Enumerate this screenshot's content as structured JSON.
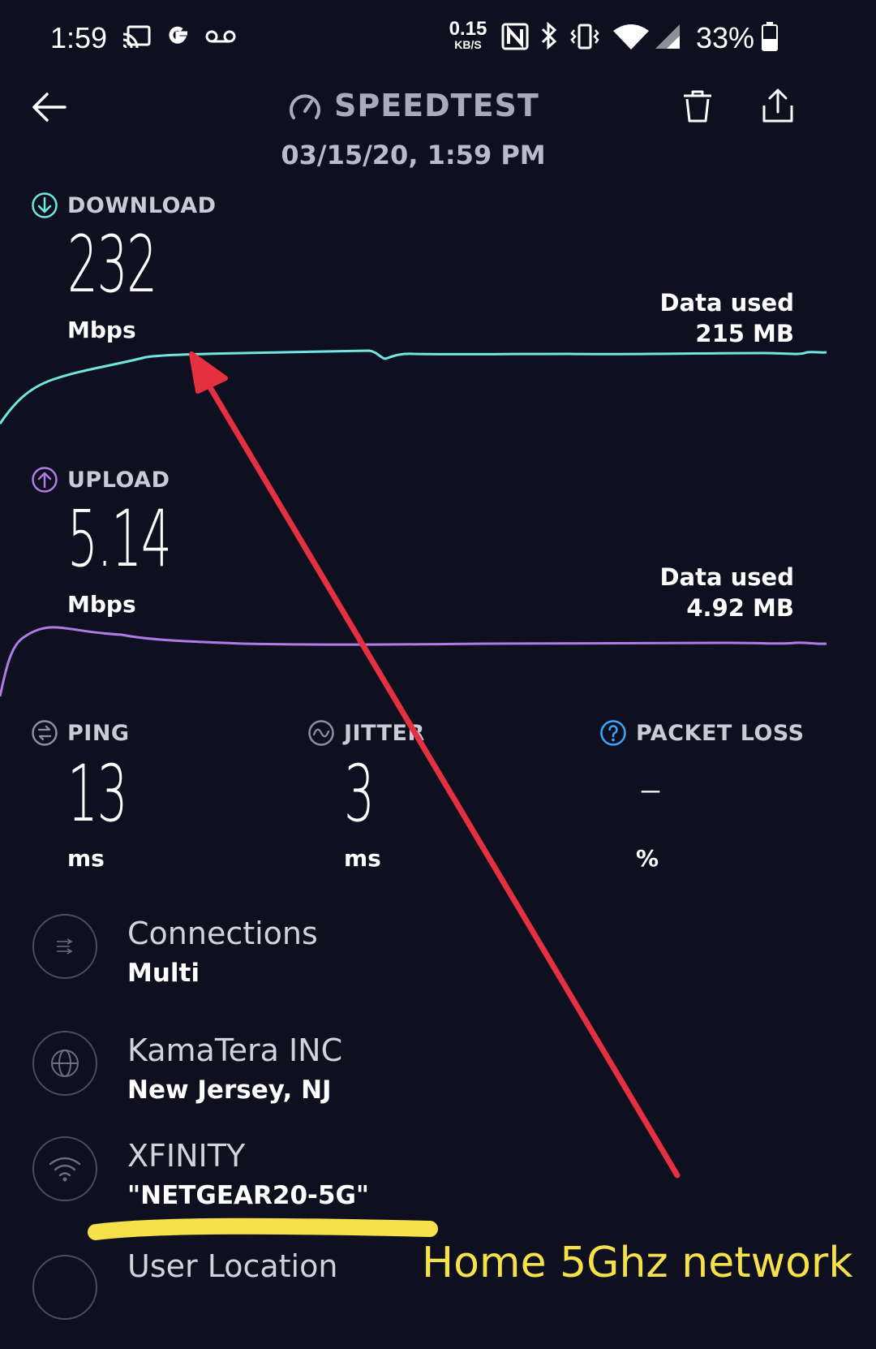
{
  "status_bar": {
    "time": "1:59",
    "speed_value": "0.15",
    "speed_unit": "KB/S",
    "battery": "33%"
  },
  "header": {
    "title": "SPEEDTEST",
    "timestamp": "03/15/20, 1:59 PM"
  },
  "download": {
    "label": "DOWNLOAD",
    "value": "232",
    "unit": "Mbps",
    "data_used_label": "Data used",
    "data_used_value": "215 MB",
    "color": "#6fe7de"
  },
  "upload": {
    "label": "UPLOAD",
    "value": "5.14",
    "unit": "Mbps",
    "data_used_label": "Data used",
    "data_used_value": "4.92 MB",
    "color": "#b07be6"
  },
  "metrics": [
    {
      "label": "PING",
      "value": "13",
      "unit": "ms"
    },
    {
      "label": "JITTER",
      "value": "3",
      "unit": "ms"
    },
    {
      "label": "PACKET LOSS",
      "value": "–",
      "unit": "%"
    }
  ],
  "info": {
    "connections_title": "Connections",
    "connections_value": "Multi",
    "server_title": "KamaTera INC",
    "server_location": "New Jersey, NJ",
    "isp_title": "XFINITY",
    "network_name": "\"NETGEAR20-5G\"",
    "user_location_title": "User Location"
  },
  "annotation": {
    "note": "Home 5Ghz network",
    "arrow_color": "#e5303f",
    "highlight_color": "#f6e14a"
  }
}
